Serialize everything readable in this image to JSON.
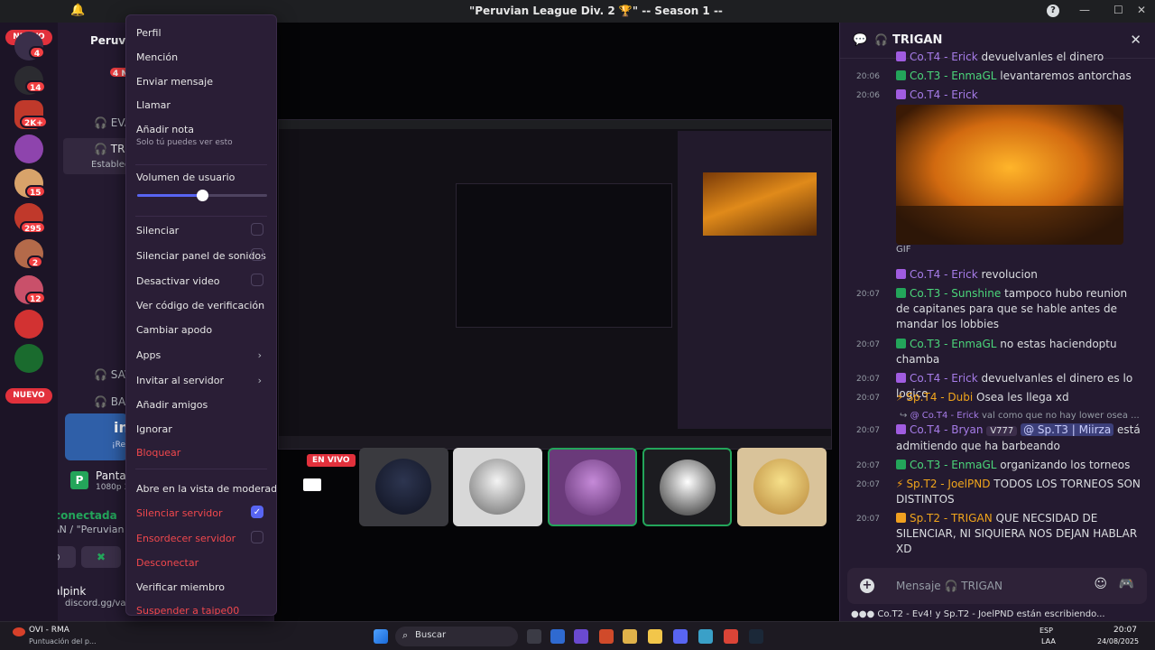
{
  "window": {
    "title": "\"Peruvian League Div. 2 🏆\" -- Season 1 --"
  },
  "rail": {
    "nuevo_top": "NUEVO",
    "nuevo_bottom": "NUEVO",
    "badges": [
      "4",
      "14",
      "2K+",
      "15",
      "295",
      "2",
      "12"
    ]
  },
  "sidebar": {
    "server_name": "Peruv",
    "voice_user_1": "EVA",
    "voice_user_2": "TRI",
    "voice_user_2_sub": "Establec",
    "voice_user_3": "SAV",
    "voice_user_4": "BAI",
    "top_badge": "4 N",
    "promo_title": "inZOI",
    "promo_sub": "¡Recompensa dispo",
    "screen_title": "Pantalla 1",
    "screen_sub": "1080p 30 FPS",
    "voice_status": "Voz conectada",
    "voice_channel": "TRIGAN / \"Peruvian l",
    "user_name": "valpink",
    "user_status": "discord.gg/va"
  },
  "context_menu": {
    "perfil": "Perfil",
    "mencion": "Mención",
    "enviar_mensaje": "Enviar mensaje",
    "llamar": "Llamar",
    "anadir_nota": "Añadir nota",
    "anadir_nota_sub": "Solo tú puedes ver esto",
    "volumen": "Volumen de usuario",
    "volumen_level": 0.5,
    "silenciar": "Silenciar",
    "silenciar_panel": "Silenciar panel de sonidos",
    "desactivar_video": "Desactivar video",
    "ver_codigo": "Ver código de verificación",
    "cambiar_apodo": "Cambiar apodo",
    "apps": "Apps",
    "invitar": "Invitar al servidor",
    "anadir_amigos": "Añadir amigos",
    "ignorar": "Ignorar",
    "bloquear": "Bloquear",
    "vista_moderador": "Abre en la vista de moderador",
    "silenciar_servidor": "Silenciar servidor",
    "silenciar_servidor_checked": true,
    "ensordecer_servidor": "Ensordecer servidor",
    "desconectar": "Desconectar",
    "verificar_miembro": "Verificar miembro",
    "suspender": "Suspender a taipe00"
  },
  "stream": {
    "live_label": "EN VIVO"
  },
  "chat": {
    "header": "TRIGAN",
    "messages": [
      {
        "ts": "",
        "author": "Co.T4 - Erick",
        "text": "devuelvanles el dinero",
        "color": "p"
      },
      {
        "ts": "20:06",
        "author": "Co.T3 - EnmaGL",
        "text": "levantaremos antorchas",
        "color": "g"
      },
      {
        "ts": "20:06",
        "author": "Co.T4 - Erick",
        "text": "",
        "color": "p"
      },
      {
        "ts": "",
        "author": "GIF",
        "text": "",
        "color": ""
      },
      {
        "ts": "",
        "author": "Co.T4 - Erick",
        "text": "revolucion",
        "color": "p"
      },
      {
        "ts": "20:07",
        "author": "Co.T3 - Sunshine",
        "text": "tampoco hubo reunion de capitanes para que se hable antes de mandar los lobbies",
        "color": "g"
      },
      {
        "ts": "20:07",
        "author": "Co.T3 - EnmaGL",
        "text": "no estas haciendoptu chamba",
        "color": "g"
      },
      {
        "ts": "20:07",
        "author": "Co.T4 - Erick",
        "text": "devuelvanles el dinero es lo logico",
        "color": "p"
      },
      {
        "ts": "20:07",
        "author": "Sp.T4 - Dubi",
        "text": "Osea les llega xd",
        "color": "o"
      },
      {
        "ts": "",
        "author": "@ Co.T4 - Erick",
        "text": "val como que no hay lower osea ...",
        "color": "p"
      },
      {
        "ts": "20:07",
        "author": "Co.T4 - Bryan",
        "text": "está admitiendo que ha barbeando",
        "color": "p",
        "extra": "V777",
        "mention": "@ Sp.T3 | Miirza"
      },
      {
        "ts": "20:07",
        "author": "Co.T3 - EnmaGL",
        "text": "organizando los torneos",
        "color": "g"
      },
      {
        "ts": "20:07",
        "author": "Sp.T2 - JoelPND",
        "text": "TODOS LOS TORNEOS SON DISTINTOS",
        "color": "o"
      },
      {
        "ts": "20:07",
        "author": "Sp.T2 - TRIGAN",
        "text": "QUE NECSIDAD DE SILENCIAR, NI SIQUIERA NOS DEJAN HABLAR XD",
        "color": "o"
      }
    ],
    "composer_placeholder": "Mensaje 🎧 TRIGAN",
    "typing": "Co.T2 - Ev4! y Sp.T2 - JoelPND están escribiendo..."
  },
  "taskbar": {
    "weather_title": "OVI - RMA",
    "weather_sub": "Puntuación del p...",
    "search": "Buscar",
    "lang": "ESP",
    "lang_sub": "LAA",
    "time": "20:07",
    "date": "24/08/2025"
  },
  "colors": {
    "accent": "#5865f2",
    "danger": "#f0484d",
    "online": "#23a55a",
    "panel": "#241a30"
  }
}
